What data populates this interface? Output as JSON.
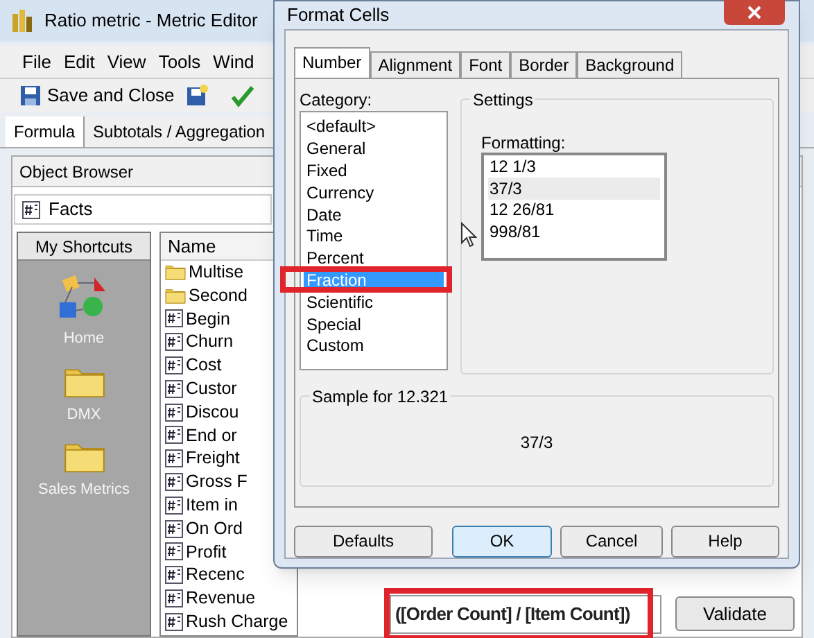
{
  "window": {
    "title": "Ratio metric - Metric Editor"
  },
  "menu": [
    "File",
    "Edit",
    "View",
    "Tools",
    "Wind"
  ],
  "toolbar": {
    "save_button": "Save and Close"
  },
  "editor_tabs": [
    {
      "label": "Formula",
      "selected": true
    },
    {
      "label": "Subtotals / Aggregation",
      "selected": false
    }
  ],
  "object_browser": {
    "title": "Object Browser",
    "folder": "Facts"
  },
  "shortcuts": {
    "title": "My Shortcuts",
    "items": [
      {
        "label": "Home",
        "kind": "home"
      },
      {
        "label": "DMX",
        "kind": "folder"
      },
      {
        "label": "Sales Metrics",
        "kind": "folder"
      }
    ]
  },
  "objects": {
    "column": "Name",
    "rows": [
      {
        "label": "Multise",
        "kind": "folder"
      },
      {
        "label": "Second",
        "kind": "folder"
      },
      {
        "label": "Begin",
        "kind": "fact"
      },
      {
        "label": "Churn",
        "kind": "fact"
      },
      {
        "label": "Cost",
        "kind": "fact"
      },
      {
        "label": "Custor",
        "kind": "fact"
      },
      {
        "label": "Discou",
        "kind": "fact"
      },
      {
        "label": "End or",
        "kind": "fact"
      },
      {
        "label": "Freight",
        "kind": "fact"
      },
      {
        "label": "Gross F",
        "kind": "fact"
      },
      {
        "label": "Item in",
        "kind": "fact"
      },
      {
        "label": "On Ord",
        "kind": "fact"
      },
      {
        "label": "Profit",
        "kind": "fact"
      },
      {
        "label": "Recenc",
        "kind": "fact"
      },
      {
        "label": "Revenue",
        "kind": "fact"
      },
      {
        "label": "Rush Charge",
        "kind": "fact"
      }
    ]
  },
  "formula": {
    "value": "([Order Count] / [Item Count])",
    "highlighted": true
  },
  "validate_button": "Validate",
  "dialog": {
    "title": "Format Cells",
    "tabs": [
      {
        "label": "Number",
        "selected": true
      },
      {
        "label": "Alignment",
        "selected": false
      },
      {
        "label": "Font",
        "selected": false
      },
      {
        "label": "Border",
        "selected": false
      },
      {
        "label": "Background",
        "selected": false
      }
    ],
    "category_label": "Category:",
    "categories": [
      {
        "label": "<default>",
        "selected": false
      },
      {
        "label": "General",
        "selected": false
      },
      {
        "label": "Fixed",
        "selected": false
      },
      {
        "label": "Currency",
        "selected": false
      },
      {
        "label": "Date",
        "selected": false
      },
      {
        "label": "Time",
        "selected": false
      },
      {
        "label": "Percent",
        "selected": false
      },
      {
        "label": "Fraction",
        "selected": true
      },
      {
        "label": "Scientific",
        "selected": false
      },
      {
        "label": "Special",
        "selected": false
      },
      {
        "label": "Custom",
        "selected": false
      }
    ],
    "settings_title": "Settings",
    "formatting_label": "Formatting:",
    "formats": [
      {
        "label": "12 1/3",
        "selected": false
      },
      {
        "label": "37/3",
        "selected": true
      },
      {
        "label": "12 26/81",
        "selected": false
      },
      {
        "label": "998/81",
        "selected": false
      }
    ],
    "sample_title": "Sample for 12.321",
    "sample_value": "37/3",
    "buttons": [
      {
        "label": "Defaults",
        "default": false
      },
      {
        "label": "OK",
        "default": true
      },
      {
        "label": "Cancel",
        "default": false
      },
      {
        "label": "Help",
        "default": false
      }
    ]
  }
}
